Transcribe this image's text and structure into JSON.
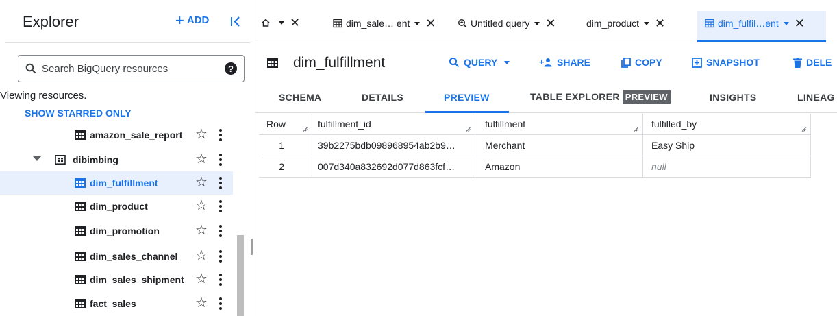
{
  "explorer": {
    "title": "Explorer",
    "add_label": "ADD",
    "search_placeholder": "Search BigQuery resources",
    "viewing_text": "Viewing resources.",
    "starred_label": "SHOW STARRED ONLY",
    "items": [
      {
        "label": "amazon_sale_report",
        "type": "table"
      },
      {
        "label": "dibimbing",
        "type": "dataset"
      },
      {
        "label": "dim_fulfillment",
        "type": "table",
        "selected": true
      },
      {
        "label": "dim_product",
        "type": "table"
      },
      {
        "label": "dim_promotion",
        "type": "table"
      },
      {
        "label": "dim_sales_channel",
        "type": "table"
      },
      {
        "label": "dim_sales_shipment",
        "type": "table"
      },
      {
        "label": "fact_sales",
        "type": "table"
      }
    ]
  },
  "editor_tabs": [
    {
      "label": "dim_sale… ent"
    },
    {
      "label": "Untitled query"
    },
    {
      "label": "dim_product"
    },
    {
      "label": "dim_fulfil…ent",
      "active": true
    }
  ],
  "toolbar": {
    "table_name": "dim_fulfillment",
    "query_label": "QUERY",
    "share_label": "SHARE",
    "copy_label": "COPY",
    "snapshot_label": "SNAPSHOT",
    "delete_label": "DELE"
  },
  "subtabs": {
    "schema": "SCHEMA",
    "details": "DETAILS",
    "preview": "PREVIEW",
    "table_explorer": "TABLE EXPLORER",
    "preview_badge": "PREVIEW",
    "insights": "INSIGHTS",
    "lineage": "LINEAG"
  },
  "table": {
    "columns": [
      "Row",
      "fulfillment_id",
      "fulfillment",
      "fulfilled_by"
    ],
    "rows": [
      {
        "row": "1",
        "fulfillment_id": "39b2275bdb098968954ab2b9…",
        "fulfillment": "Merchant",
        "fulfilled_by": "Easy Ship"
      },
      {
        "row": "2",
        "fulfillment_id": "007d340a832692d077d863fcf…",
        "fulfillment": "Amazon",
        "fulfilled_by": "null"
      }
    ]
  },
  "colors": {
    "accent": "#1a73e8",
    "selected_bg": "#e8f0fe"
  }
}
